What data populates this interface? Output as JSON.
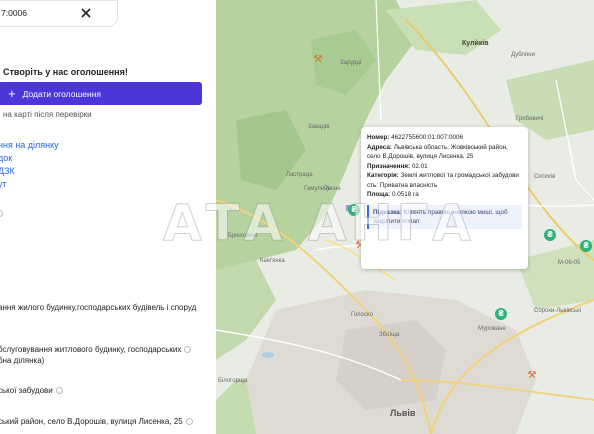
{
  "search": {
    "value": "7:0006"
  },
  "promo": {
    "text": "Створіть у нас оголошення!",
    "button_label": "Додати оголошення",
    "note": "на карті після перевірки"
  },
  "links": [
    "ння на ділянку",
    "док",
    "ДЗК",
    "ут"
  ],
  "info": {
    "line1": "ання жилого будинку,господарських будівель і споруд",
    "line2": "бслуговування житлового будинку, господарських",
    "line3": "бна ділянка)",
    "line4": "ської забудови",
    "line5": "ський район, село В.Дорошів, вулиця Лисенка, 25"
  },
  "popup": {
    "number_label": "Номер:",
    "number_value": "4622755600:01:007:0006",
    "address_label": "Адреса:",
    "address_value": "Львівська область, Жовківський район, село В.Дорошів, вулиця Лисенка, 25",
    "purpose_label": "Призначення:",
    "purpose_value": "02.01",
    "category_label": "Категорія:",
    "category_value": "Землі житлової та громадської забудови",
    "ownership_value": "сть: Приватна власність",
    "area_label": "Площа:",
    "area_value": "0.0518 га",
    "hint_label": "Підказка:",
    "hint_text": "Клікніть правою кнопкою миші, щоб закріпити попап"
  },
  "map_labels": {
    "kulykiv": "Кулѝків",
    "zavadiv": "Завадів",
    "lviv": "Львів",
    "bryukhovychi": "Брюховичі",
    "holosko": "Голоско",
    "zboishcha": "Збоїща",
    "murovane": "Муроване",
    "sytykhiv": "Ситихів",
    "sorokiv": "Сороки-Львівські",
    "bilohorshcha": "Білогорща",
    "m0605": "М-06-05",
    "hrybovychi": "Грибовичі",
    "dublyany": "Дубляни",
    "zvirko": "Зарудці",
    "hamulets": "Гамулець",
    "as_hryda": "Ластрада",
    "kamenka": "Кам'янка",
    "ryasne": "Рясне"
  },
  "watermark": "АТА АНГА",
  "colors": {
    "accent": "#4c36d8",
    "link": "#2668d9",
    "pin": "#2fb07c"
  }
}
